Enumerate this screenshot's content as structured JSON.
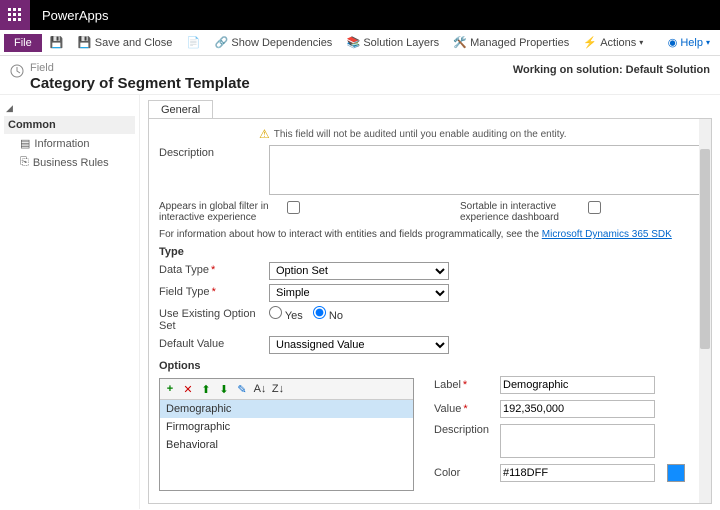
{
  "brand": "PowerApps",
  "file": "File",
  "cmds": {
    "save": "",
    "saveClose": "Save and Close",
    "dup": "",
    "deps": "Show Dependencies",
    "layers": "Solution Layers",
    "managed": "Managed Properties",
    "actions": "Actions"
  },
  "help": "Help",
  "crumb": "Field",
  "title": "Category of Segment Template",
  "workingOn": "Working on solution: Default Solution",
  "side": {
    "header": "Common",
    "items": [
      "Information",
      "Business Rules"
    ]
  },
  "tab": "General",
  "warn": "This field will not be audited until you enable auditing on the entity.",
  "desc": {
    "label": "Description",
    "value": ""
  },
  "gf": {
    "label": "Appears in global filter in interactive experience"
  },
  "sort": {
    "label": "Sortable in interactive experience dashboard"
  },
  "infoText": "For information about how to interact with entities and fields programmatically, see the ",
  "infoLink": "Microsoft Dynamics 365 SDK",
  "type": {
    "header": "Type",
    "dataType": {
      "label": "Data Type",
      "value": "Option Set"
    },
    "fieldType": {
      "label": "Field Type",
      "value": "Simple"
    },
    "useExisting": {
      "label": "Use Existing Option Set",
      "yes": "Yes",
      "no": "No"
    },
    "defaultVal": {
      "label": "Default Value",
      "value": "Unassigned Value"
    }
  },
  "options": {
    "header": "Options",
    "items": [
      "Demographic",
      "Firmographic",
      "Behavioral"
    ],
    "form": {
      "label": {
        "l": "Label",
        "v": "Demographic"
      },
      "value": {
        "l": "Value",
        "v": "192,350,000"
      },
      "desc": {
        "l": "Description",
        "v": ""
      },
      "color": {
        "l": "Color",
        "v": "#118DFF"
      }
    }
  }
}
